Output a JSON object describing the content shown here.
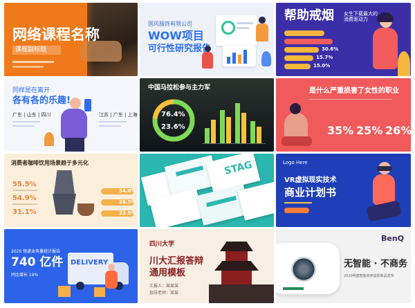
{
  "tiles": [
    {
      "id": "online-course",
      "title": "网络课程名称",
      "subtitle": "课程副标题",
      "bg": "#f07a1a"
    },
    {
      "id": "wow-project",
      "company": "国风服饰有限公司",
      "title": "WOW项目",
      "subtitle": "可行性研究报告",
      "bg": "#eef2f8",
      "accent": "#2d6ff0"
    },
    {
      "id": "quit-smoking",
      "title": "帮助戒烟",
      "caption": "女生下载最大的\n消费驱动力",
      "bars": [
        {
          "label": "",
          "value": "",
          "pct": 0.58
        },
        {
          "label": "",
          "value": "",
          "pct": 0.7
        },
        {
          "label": "",
          "value": "30.6%",
          "pct": 0.5
        },
        {
          "label": "",
          "value": "15.7%",
          "pct": 0.42
        },
        {
          "label": "",
          "value": "15.0%",
          "pct": 0.38
        }
      ],
      "bg": "#3b2fa8"
    },
    {
      "id": "working-cities",
      "headline_1": "同样是在离开",
      "headline_2": "各有各的乐趣!",
      "left_cities": "广东 | 山东 | 四川",
      "right_cities": "江苏 | 广东 | 上海",
      "bg": "#f4f6fb"
    },
    {
      "id": "marathon",
      "title": "中国马拉松参与主力军",
      "stat_1": "76.4%",
      "stat_2": "23.6%",
      "bg": "#101418"
    },
    {
      "id": "women-careers",
      "title": "是什么严重损害了女性的职业",
      "stats": [
        "35%",
        "25%",
        "26%"
      ],
      "bg": "#f05a5a"
    },
    {
      "id": "coffee",
      "title": "消费者咖啡饮用场景趋于多元化",
      "left_stats": [
        "55.5%",
        "54.9%",
        "31.1%"
      ],
      "right_stats": [
        "34.0%",
        "28.3%",
        "23.5%"
      ],
      "bg": "#fbeedb"
    },
    {
      "id": "stack-templates",
      "badge": "STAG",
      "bg": "#2bb7b0"
    },
    {
      "id": "vr-plan",
      "logo": "Logo Here",
      "title_1": "VR虚拟现实技术",
      "title_2": "商业计划书",
      "bg": "#1f3fb8"
    },
    {
      "id": "delivery",
      "top": "2020 快递业务量统计报告",
      "number": "740 亿件",
      "sub": "同比增长 19%",
      "truck_label": "DELIVERY",
      "bg": "#2c63e8"
    },
    {
      "id": "sichuan-univ",
      "logo": "四川大学",
      "title_1": "川大汇报答辩",
      "title_2": "通用模板",
      "reporter": "汇报人：某某某",
      "advisor": "指导老师：某某",
      "bg": "#f7eee4"
    },
    {
      "id": "benq",
      "brand": "BenQ",
      "slogan": "无智能 · 不商务",
      "sub": "2020明基智能商务投影新品发布",
      "bg": "#f2f2f2"
    }
  ]
}
